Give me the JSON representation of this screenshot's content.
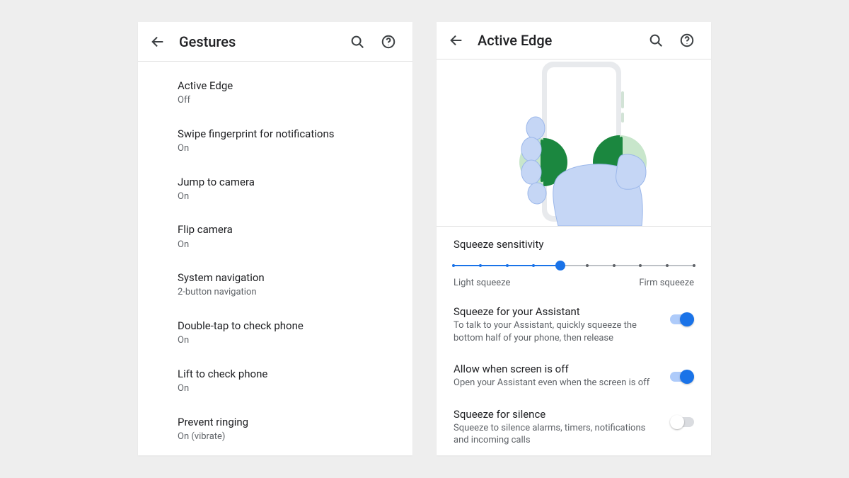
{
  "left": {
    "title": "Gestures",
    "items": [
      {
        "label": "Active Edge",
        "status": "Off"
      },
      {
        "label": "Swipe fingerprint for notifications",
        "status": "On"
      },
      {
        "label": "Jump to camera",
        "status": "On"
      },
      {
        "label": "Flip camera",
        "status": "On"
      },
      {
        "label": "System navigation",
        "status": "2-button navigation"
      },
      {
        "label": "Double-tap to check phone",
        "status": "On"
      },
      {
        "label": "Lift to check phone",
        "status": "On"
      },
      {
        "label": "Prevent ringing",
        "status": "On (vibrate)"
      }
    ]
  },
  "right": {
    "title": "Active Edge",
    "slider": {
      "header": "Squeeze sensitivity",
      "min_label": "Light squeeze",
      "max_label": "Firm squeeze",
      "steps": 10,
      "value_index": 4
    },
    "rows": [
      {
        "label": "Squeeze for your Assistant",
        "desc": "To talk to your Assistant, quickly squeeze the bottom half of your phone, then release",
        "on": true
      },
      {
        "label": "Allow when screen is off",
        "desc": "Open your Assistant even when the screen is off",
        "on": true
      },
      {
        "label": "Squeeze for silence",
        "desc": "Squeeze to silence alarms, timers, notifications and incoming calls",
        "on": false
      }
    ]
  },
  "colors": {
    "accent": "#1a73e8"
  }
}
